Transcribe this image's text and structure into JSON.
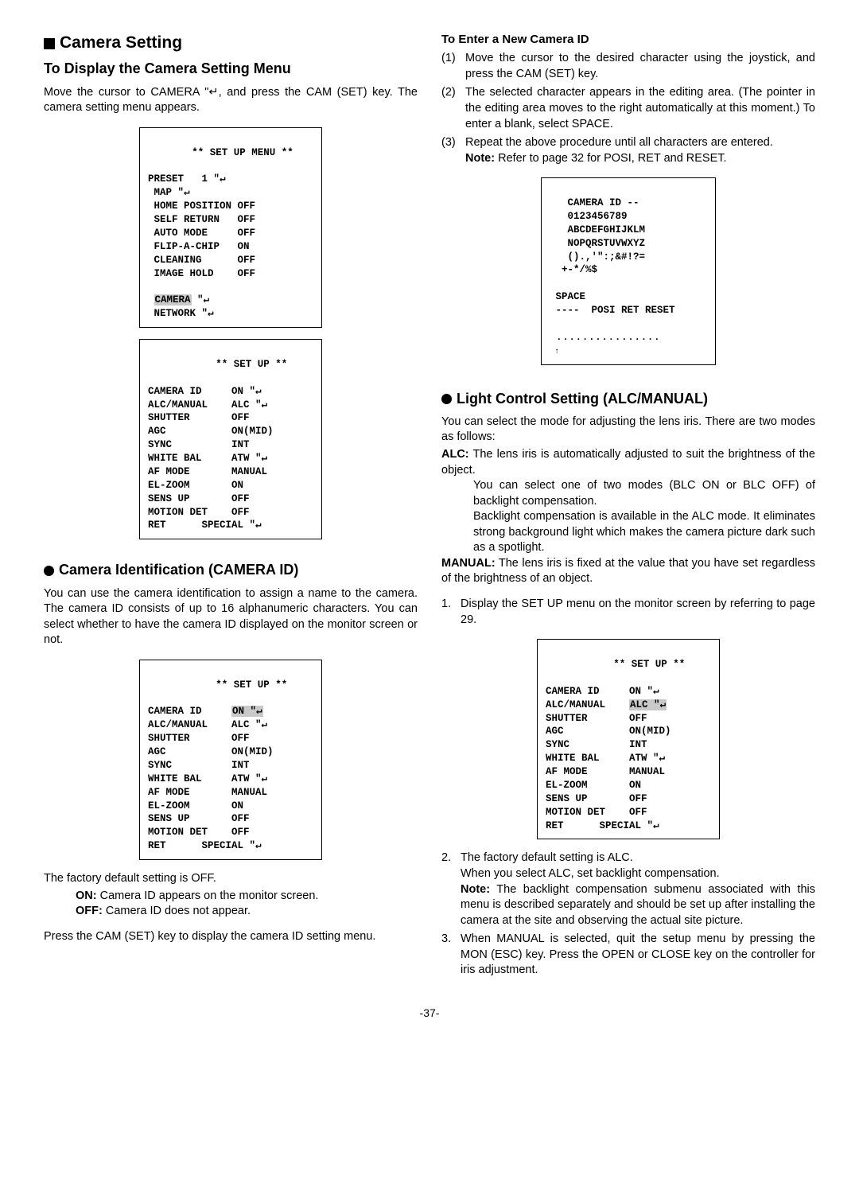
{
  "page_number": "-37-",
  "left": {
    "section_title": "Camera Setting",
    "subhead1": "To Display the Camera Setting Menu",
    "intro_a": "Move the cursor to CAMERA ",
    "intro_b": ", and press the CAM (SET) key. The camera setting menu appears.",
    "menu1": {
      "title_line": "    ** SET UP MENU **",
      "lines": [
        "PRESET   1 \"↵",
        " MAP \"↵",
        " HOME POSITION OFF",
        " SELF RETURN   OFF",
        " AUTO MODE     OFF",
        " FLIP-A-CHIP   ON",
        " CLEANING      OFF",
        " IMAGE HOLD    OFF",
        "",
        " CAMERA \"↵",
        " NETWORK \"↵"
      ],
      "highlight_index": 9
    },
    "menu2": {
      "title_line": "       ** SET UP **",
      "lines": [
        "CAMERA ID     ON \"↵",
        "ALC/MANUAL    ALC \"↵",
        "SHUTTER       OFF",
        "AGC           ON(MID)",
        "SYNC          INT",
        "WHITE BAL     ATW \"↵",
        "AF MODE       MANUAL",
        "EL-ZOOM       ON",
        "SENS UP       OFF",
        "MOTION DET    OFF",
        "RET      SPECIAL \"↵"
      ]
    },
    "cam_id_head": "Camera Identification (CAMERA ID)",
    "cam_id_para": "You can use the camera identification to assign a name to the camera. The camera ID consists of up to 16 alphanumeric characters. You can select whether to have the camera ID displayed on the monitor screen or not.",
    "menu3": {
      "title_line": "       ** SET UP **",
      "lines": [
        "CAMERA ID     ON \"↵",
        "ALC/MANUAL    ALC \"↵",
        "SHUTTER       OFF",
        "AGC           ON(MID)",
        "SYNC          INT",
        "WHITE BAL     ATW \"↵",
        "AF MODE       MANUAL",
        "EL-ZOOM       ON",
        "SENS UP       OFF",
        "MOTION DET    OFF",
        "RET      SPECIAL \"↵"
      ],
      "highlight_line0_value": "ON \"↵"
    },
    "factory_line": "The factory default setting is OFF.",
    "on_label": "ON:",
    "on_text": " Camera ID appears on the monitor screen.",
    "off_label": "OFF:",
    "off_text": " Camera ID does not appear.",
    "press_cam": "Press the CAM (SET) key to display the camera ID setting menu."
  },
  "right": {
    "enter_head": "To Enter a New Camera ID",
    "steps": [
      {
        "n": "(1)",
        "t": "Move the cursor to the desired character using the joystick, and press the CAM (SET) key."
      },
      {
        "n": "(2)",
        "t": "The selected character appears in the editing area. (The pointer in the editing area moves to the right automatically at this moment.) To enter a blank, select SPACE."
      },
      {
        "n": "(3)",
        "t": "Repeat the above procedure until all characters are entered."
      }
    ],
    "note_label": "Note:",
    "note_text": " Refer to page 32 for POSI, RET and RESET.",
    "char_menu": {
      "lines": [
        "   CAMERA ID --",
        "   0123456789",
        "   ABCDEFGHIJKLM",
        "   NOPQRSTUVWXYZ",
        "   ().,'\":;&#!?=",
        "  +-*/%$",
        "",
        " SPACE",
        " ----  POSI RET RESET",
        "",
        " ................",
        " ↑"
      ]
    },
    "light_head": "Light Control Setting (ALC/MANUAL)",
    "light_intro": "You can select the mode for adjusting the lens iris. There are two modes as follows:",
    "alc_label": "ALC:",
    "alc_text1": " The lens iris is automatically adjusted to suit the brightness of the object.",
    "alc_text2": "You can select one of two modes (BLC ON or BLC OFF) of backlight compensation.",
    "alc_text3": "Backlight compensation is available in the ALC mode. It eliminates strong background light which makes the camera picture dark such as a spotlight.",
    "man_label": "MANUAL:",
    "man_text": " The lens iris is fixed at the value that you have set regardless of the brightness of an object.",
    "num_items": [
      {
        "n": "1.",
        "t": "Display the SET UP menu on the monitor screen by referring to page 29."
      }
    ],
    "menu4": {
      "title_line": "       ** SET UP **",
      "lines": [
        "CAMERA ID     ON \"↵",
        "ALC/MANUAL    ALC \"↵",
        "SHUTTER       OFF",
        "AGC           ON(MID)",
        "SYNC          INT",
        "WHITE BAL     ATW \"↵",
        "AF MODE       MANUAL",
        "EL-ZOOM       ON",
        "SENS UP       OFF",
        "MOTION DET    OFF",
        "RET      SPECIAL \"↵"
      ],
      "highlight_line1_value": "ALC \"↵"
    },
    "item2a": "The factory default setting is ALC.",
    "item2b": "When you select ALC, set backlight compensation.",
    "item2_note_label": "Note:",
    "item2_note": " The backlight compensation submenu associated with this menu is described separately and should be set up after installing the camera at the site and observing the actual site picture.",
    "item3": "When MANUAL is selected, quit the setup menu by pressing the MON (ESC) key. Press the OPEN or CLOSE key on the controller for iris adjustment."
  }
}
